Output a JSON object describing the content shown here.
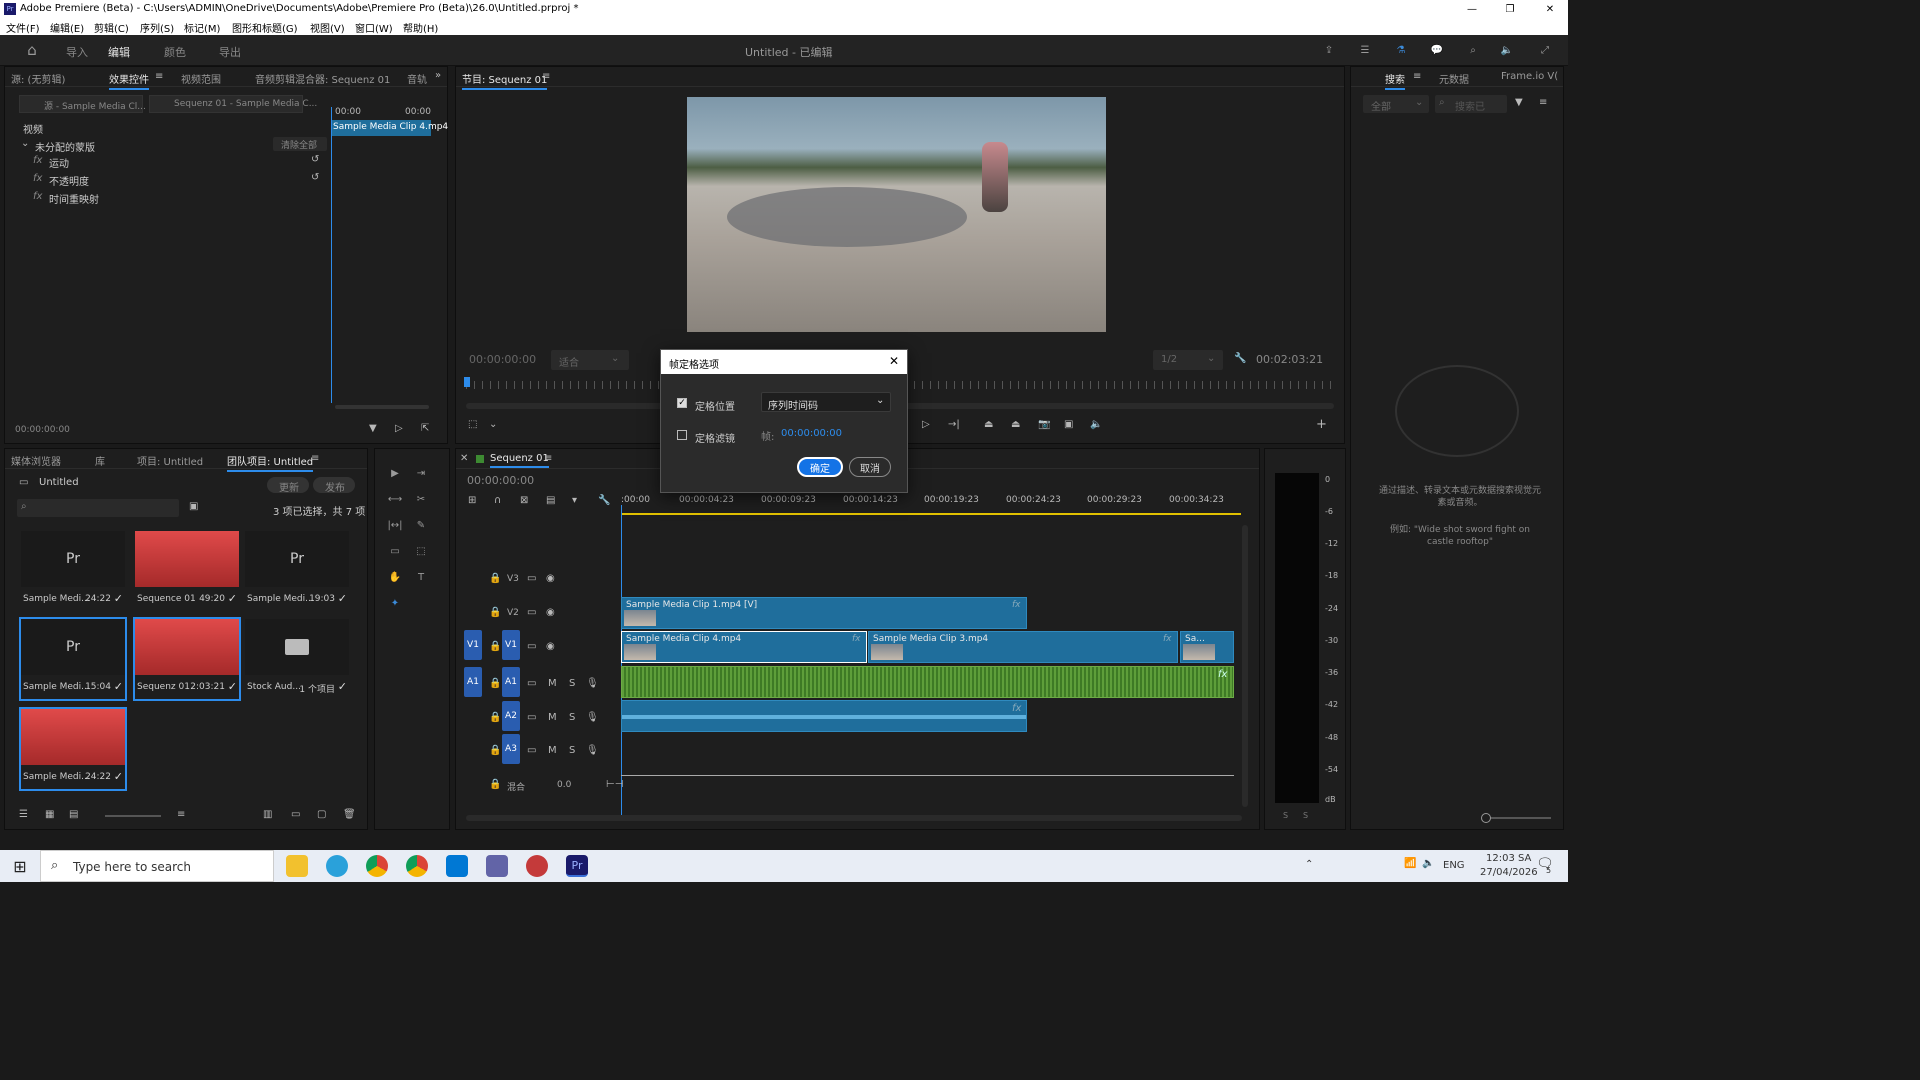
{
  "window": {
    "title": "Adobe Premiere (Beta) - C:\\Users\\ADMIN\\OneDrive\\Documents\\Adobe\\Premiere Pro (Beta)\\26.0\\Untitled.prproj *",
    "app_icon": "Pr"
  },
  "menu": [
    "文件(F)",
    "编辑(E)",
    "剪辑(C)",
    "序列(S)",
    "标记(M)",
    "图形和标题(G)",
    "视图(V)",
    "窗口(W)",
    "帮助(H)"
  ],
  "topbar": {
    "workspaces": [
      "导入",
      "编辑",
      "颜色",
      "导出"
    ],
    "active_workspace": "编辑",
    "project_title": "Untitled - 已编辑"
  },
  "effect_controls": {
    "tabs": [
      "源: (无剪辑)",
      "效果控件",
      "视频范围",
      "音频剪辑混合器: Sequenz 01",
      "音轨"
    ],
    "active_tab": "效果控件",
    "source_chip": "源 - Sample Media Cl...",
    "sequence_chip": "Sequenz 01 - Sample Media C...",
    "section_video": "视频",
    "unassigned": "未分配的蒙版",
    "clear_all": "清除全部",
    "effects": [
      "运动",
      "不透明度",
      "时间重映射"
    ],
    "time_start": "00:00",
    "time_end": "00:00",
    "clip_label": "Sample Media Clip 4.mp4",
    "timecode": "00:00:00:00"
  },
  "program_monitor": {
    "title": "节目: Sequenz 01",
    "timecode_left": "00:00:00:00",
    "fit": "适合",
    "resolution": "1/2",
    "timecode_right": "00:02:03:21"
  },
  "right_panel": {
    "tabs": [
      "搜索",
      "元数据",
      "Frame.io V("
    ],
    "active_tab": "搜索",
    "filter": "全部",
    "search_placeholder": "搜索已",
    "hint": "通过描述、转录文本或元数据搜索视觉元素或音频。",
    "example": "例如: \"Wide shot sword fight on castle rooftop\""
  },
  "project_panel": {
    "tabs": [
      "媒体浏览器",
      "库",
      "项目: Untitled",
      "团队项目: Untitled"
    ],
    "active_tab": "团队项目: Untitled",
    "folder": "Untitled",
    "update_btn": "更新",
    "publish_btn": "发布",
    "selection_info": "3 项已选择，共 7 项",
    "items": [
      {
        "label": "Sample Medi...",
        "duration": "24:22",
        "kind": "pr",
        "selected": false
      },
      {
        "label": "Sequence 01",
        "duration": "49:20",
        "kind": "red",
        "selected": false
      },
      {
        "label": "Sample Medi...",
        "duration": "19:03",
        "kind": "pr",
        "selected": false
      },
      {
        "label": "Sample Medi...",
        "duration": "15:04",
        "kind": "pr",
        "selected": true
      },
      {
        "label": "Sequenz 01",
        "duration": "2:03:21",
        "kind": "red",
        "selected": true
      },
      {
        "label": "Stock Aud...",
        "duration": "1 个项目",
        "kind": "folder",
        "selected": false
      },
      {
        "label": "Sample Medi...",
        "duration": "24:22",
        "kind": "red",
        "selected": true
      }
    ]
  },
  "timeline": {
    "title": "Sequenz 01",
    "timecode": "00:00:00:00",
    "ruler": [
      ":00:00",
      "00:00:04:23",
      "00:00:09:23",
      "00:00:14:23",
      "00:00:19:23",
      "00:00:24:23",
      "00:00:29:23",
      "00:00:34:23"
    ],
    "tracks": [
      "V3",
      "V2",
      "V1",
      "A1",
      "A2",
      "A3"
    ],
    "mix_label": "混合",
    "mix_value": "0.0",
    "clips": {
      "v2": "Sample Media Clip 1.mp4 [V]",
      "v1a": "Sample Media Clip 4.mp4",
      "v1b": "Sample Media Clip 3.mp4",
      "v1c": "Sa..."
    }
  },
  "meter": {
    "scale": [
      "0",
      "-6",
      "-12",
      "-18",
      "-24",
      "-30",
      "-36",
      "-42",
      "-48",
      "-54",
      "dB"
    ],
    "channels": [
      "S",
      "S"
    ]
  },
  "dialog": {
    "title": "帧定格选项",
    "hold_position_label": "定格位置",
    "hold_position_checked": true,
    "hold_position_value": "序列时间码",
    "hold_filter_label": "定格滤镜",
    "hold_filter_checked": false,
    "frame_label": "帧:",
    "frame_value": "00:00:00:00",
    "ok": "确定",
    "cancel": "取消"
  },
  "taskbar": {
    "search_placeholder": "Type here to search",
    "lang": "ENG",
    "time": "12:03 SA",
    "date": "27/04/2026",
    "notifications": "5"
  },
  "colors": {
    "accent": "#2d8ceb",
    "clip_video": "#1f6e9c",
    "clip_audio": "#3e7a25",
    "panel": "#1e1e1e"
  }
}
